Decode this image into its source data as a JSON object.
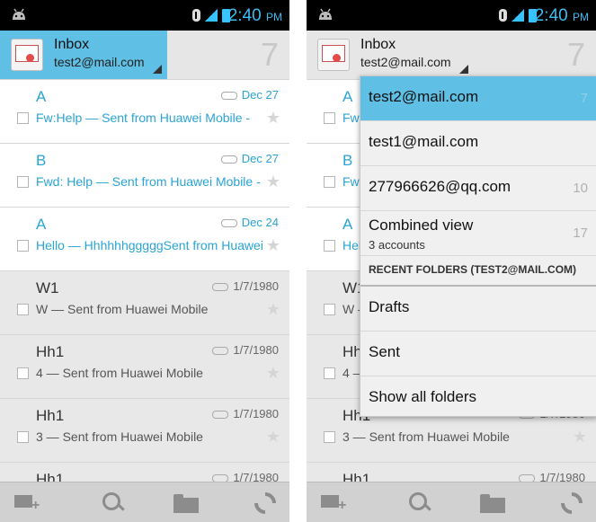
{
  "status": {
    "time": "2:40",
    "ampm": "PM"
  },
  "header": {
    "title": "Inbox",
    "account_email": "test2@mail.com",
    "unread_count": "7"
  },
  "messages": [
    {
      "sender": "A",
      "date": "Dec 27",
      "subject": "Fw:Help — Sent from Huawei Mobile -",
      "unread": true
    },
    {
      "sender": "B",
      "date": "Dec 27",
      "subject": "Fwd: Help — Sent from Huawei Mobile -",
      "unread": true
    },
    {
      "sender": "A",
      "date": "Dec 24",
      "subject": "Hello — HhhhhhgggggSent from Huawei",
      "unread": true
    },
    {
      "sender": "W1",
      "date": "1/7/1980",
      "subject": "W — Sent from Huawei Mobile",
      "unread": false
    },
    {
      "sender": "Hh1",
      "date": "1/7/1980",
      "subject": "4 — Sent from Huawei Mobile",
      "unread": false
    },
    {
      "sender": "Hh1",
      "date": "1/7/1980",
      "subject": "3 — Sent from Huawei Mobile",
      "unread": false
    },
    {
      "sender": "Hh1",
      "date": "1/7/1980",
      "subject": "",
      "unread": false
    }
  ],
  "right_messages": [
    {
      "sender": "A",
      "date": "",
      "subject": "Fw:",
      "unread": true
    },
    {
      "sender": "B",
      "date": "",
      "subject": "Fwd",
      "unread": true
    },
    {
      "sender": "A",
      "date": "",
      "subject": "Hel",
      "unread": true
    },
    {
      "sender": "W1",
      "date": "",
      "subject": "W –",
      "unread": false
    },
    {
      "sender": "Hh",
      "date": "",
      "subject": "4 –",
      "unread": false
    },
    {
      "sender": "Hh1",
      "date": "1/7/1980",
      "subject": "3 — Sent from Huawei Mobile",
      "unread": false
    },
    {
      "sender": "Hh1",
      "date": "1/7/1980",
      "subject": "",
      "unread": false
    }
  ],
  "account_dropdown": {
    "accounts": [
      {
        "email": "test2@mail.com",
        "count": "7",
        "selected": true
      },
      {
        "email": "test1@mail.com",
        "count": "",
        "selected": false
      },
      {
        "email": "277966626@qq.com",
        "count": "10",
        "selected": false
      }
    ],
    "combined": {
      "label": "Combined view",
      "sub": "3 accounts",
      "count": "17"
    },
    "recent_header": "RECENT FOLDERS (TEST2@MAIL.COM)",
    "folders": [
      "Drafts",
      "Sent"
    ],
    "show_all": "Show all folders"
  },
  "colors": {
    "accent": "#5fbfe4",
    "unread_text": "#2aa4d4"
  },
  "icons": [
    "android-icon",
    "bluetooth-icon",
    "signal-icon",
    "battery-icon",
    "mail-icon",
    "compose-icon",
    "search-icon",
    "folder-icon",
    "refresh-icon",
    "star-icon",
    "label-icon"
  ]
}
